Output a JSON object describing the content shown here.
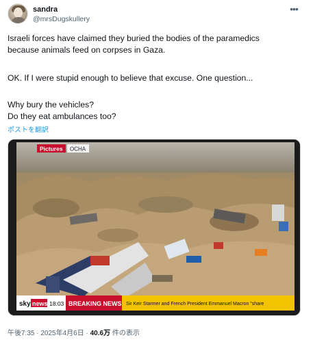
{
  "author": {
    "display_name": "sandra",
    "handle": "@mrsDugskullery"
  },
  "tweet": {
    "lines": [
      "Israeli forces have claimed they buried the bodies of the paramedics",
      "because animals feed on corpses in Gaza.",
      "OK. If I were stupid enough to believe that excuse. One question...",
      "Why bury the vehicles?",
      "Do they eat ambulances too?"
    ],
    "translate_label": "ポストを翻訳"
  },
  "media": {
    "tv_badge": "Pictures",
    "tv_source": "OCHA",
    "network_logo_a": "sky",
    "network_logo_b": "news",
    "clock": "18:03",
    "breaking_label": "BREAKING NEWS",
    "ticker": "Sir Keir Starmer and French President Emmanuel Macron \"share"
  },
  "meta": {
    "time": "午後7:35",
    "separator": " · ",
    "date": "2025年4月6日",
    "views_count": "40.6万",
    "views_label": " 件の表示"
  },
  "colors": {
    "link": "#1d9bf0",
    "breaking_bg": "#c8102e",
    "ticker_bg": "#f3c300"
  }
}
